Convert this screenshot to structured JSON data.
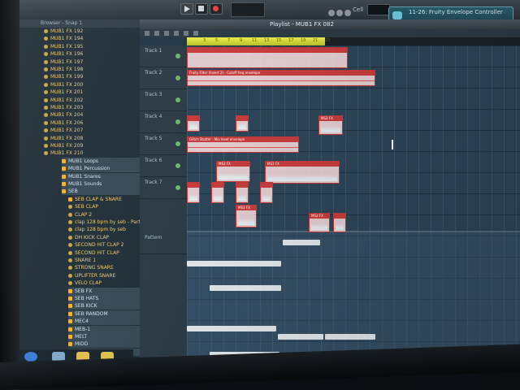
{
  "toolbar": {
    "cell_label": "Cell",
    "plugin_picker_text": "11-26: Fruity Envelope Controller"
  },
  "browser": {
    "header_text": "Browser - Snap 1",
    "items": [
      {
        "label": "MUB1 FX 192",
        "type": "file"
      },
      {
        "label": "MUB1 FX 194",
        "type": "file"
      },
      {
        "label": "MUB1 FX 195",
        "type": "file"
      },
      {
        "label": "MUB1 FX 196",
        "type": "file"
      },
      {
        "label": "MUB1 FX 197",
        "type": "file"
      },
      {
        "label": "MUB1 FX 198",
        "type": "file"
      },
      {
        "label": "MUB1 FX 199",
        "type": "file"
      },
      {
        "label": "MUB1 FX 200",
        "type": "file"
      },
      {
        "label": "MUB1 FX 201",
        "type": "file"
      },
      {
        "label": "MUB1 FX 202",
        "type": "file"
      },
      {
        "label": "MUB1 FX 203",
        "type": "file"
      },
      {
        "label": "MUB1 FX 204",
        "type": "file"
      },
      {
        "label": "MUB1 FX 206",
        "type": "file"
      },
      {
        "label": "MUB1 FX 207",
        "type": "file"
      },
      {
        "label": "MUB1 FX 208",
        "type": "file"
      },
      {
        "label": "MUB1 FX 209",
        "type": "file"
      },
      {
        "label": "MUB1 FX 210",
        "type": "file"
      },
      {
        "label": "MUB1 Loops",
        "type": "folder"
      },
      {
        "label": "MUB1 Percussion",
        "type": "folder"
      },
      {
        "label": "MUB1 Snares",
        "type": "folder"
      },
      {
        "label": "MUB1 Sounds",
        "type": "folder"
      },
      {
        "label": "SEB",
        "type": "folder"
      },
      {
        "label": "SEB CLAP & SNARE",
        "type": "folder"
      },
      {
        "label": "SEB CLAP",
        "type": "file"
      },
      {
        "label": "CLAP 2",
        "type": "file"
      },
      {
        "label": "clap 128 bpm by seb - Part_1",
        "type": "file"
      },
      {
        "label": "clap 128 bpm by seb",
        "type": "file"
      },
      {
        "label": "DH KICK CLAP",
        "type": "file"
      },
      {
        "label": "SECOND HIT CLAP 2",
        "type": "file"
      },
      {
        "label": "SECOND HIT CLAP",
        "type": "file"
      },
      {
        "label": "SNARE 1",
        "type": "file"
      },
      {
        "label": "STRONG SNARE",
        "type": "file"
      },
      {
        "label": "UPLIFTER SNARE",
        "type": "file"
      },
      {
        "label": "VELO CLAP",
        "type": "file"
      },
      {
        "label": "SEB FX",
        "type": "folder"
      },
      {
        "label": "SEB HATS",
        "type": "folder"
      },
      {
        "label": "SEB KICK",
        "type": "folder"
      },
      {
        "label": "SEB RANDOM",
        "type": "folder"
      },
      {
        "label": "MEC4",
        "type": "folder"
      },
      {
        "label": "MEB-1",
        "type": "folder"
      },
      {
        "label": "MELT",
        "type": "folder"
      },
      {
        "label": "MIDD",
        "type": "folder"
      },
      {
        "label": "MOXL",
        "type": "folder"
      }
    ]
  },
  "playlist": {
    "title": "Playlist - MUB1 FX 082",
    "ruler_ticks": [
      "3",
      "5",
      "7",
      "9",
      "11",
      "13",
      "15",
      "17",
      "19",
      "21",
      "23"
    ],
    "tracks": [
      "Track 1",
      "Track 2",
      "Track 3",
      "Track 4",
      "Track 5",
      "Track 6",
      "Track 7"
    ],
    "clips": [
      {
        "label": "Fruity Filter (Insert 2) - Cutoff freq envelope"
      },
      {
        "label": "Glitch Stutter - Mix level envelope"
      },
      {
        "label": "MS3 FX"
      },
      {
        "label": "MS3 FX"
      },
      {
        "label": "MS3 FX"
      },
      {
        "label": "MS3 FX"
      },
      {
        "label": "MS3 FX"
      }
    ],
    "pattern_label": "Pattern"
  },
  "colors": {
    "clip_header": "#c63d3d",
    "clip_body": "#ffe2e2",
    "ruler_yellow": "#e9ec4c",
    "folder_icon": "#f2b233",
    "plugin_teal": "#2a5f6f"
  }
}
